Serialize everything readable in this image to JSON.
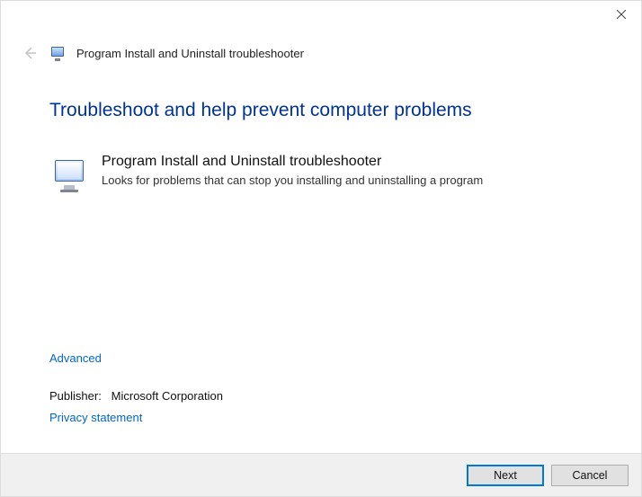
{
  "window": {
    "title": "Program Install and Uninstall troubleshooter"
  },
  "main": {
    "heading": "Troubleshoot and help prevent computer problems",
    "item": {
      "title": "Program Install and Uninstall troubleshooter",
      "description": "Looks for problems that can stop you installing and uninstalling a program"
    }
  },
  "links": {
    "advanced": "Advanced",
    "privacy": "Privacy statement"
  },
  "publisher": {
    "label": "Publisher:",
    "value": "Microsoft Corporation"
  },
  "footer": {
    "next": "Next",
    "cancel": "Cancel"
  }
}
